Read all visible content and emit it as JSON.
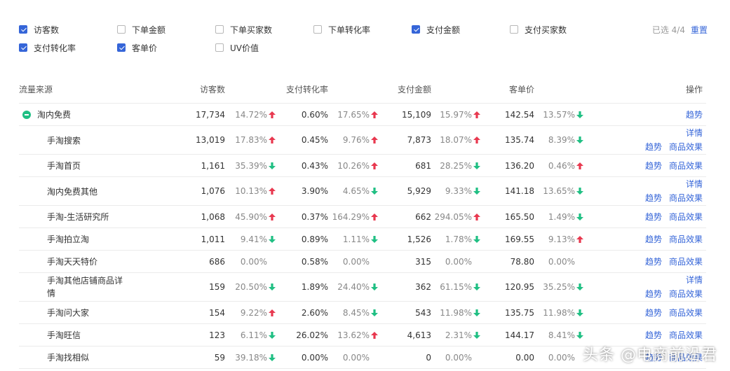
{
  "filters": [
    {
      "label": "访客数",
      "checked": true,
      "name": "filter-visitors"
    },
    {
      "label": "下单金额",
      "checked": false,
      "name": "filter-order-amount"
    },
    {
      "label": "下单买家数",
      "checked": false,
      "name": "filter-order-buyers"
    },
    {
      "label": "下单转化率",
      "checked": false,
      "name": "filter-order-conversion"
    },
    {
      "label": "支付金额",
      "checked": true,
      "name": "filter-pay-amount"
    },
    {
      "label": "支付买家数",
      "checked": false,
      "name": "filter-pay-buyers"
    },
    {
      "label": "支付转化率",
      "checked": true,
      "name": "filter-pay-conversion"
    },
    {
      "label": "客单价",
      "checked": true,
      "name": "filter-unit-price"
    },
    {
      "label": "UV价值",
      "checked": false,
      "name": "filter-uv-value"
    }
  ],
  "selection": {
    "count_text": "已选 4/4",
    "reset_label": "重置"
  },
  "table": {
    "headers": {
      "source": "流量来源",
      "visitors": "访客数",
      "pay_conversion": "支付转化率",
      "pay_amount": "支付金额",
      "unit_price": "客单价",
      "actions": "操作"
    },
    "rows": [
      {
        "source": "淘内免费",
        "parent": true,
        "v1": "17,734",
        "p1": "14.72%",
        "d1": "up",
        "v2": "0.60%",
        "p2": "17.65%",
        "d2": "up",
        "v3": "15,109",
        "p3": "15.97%",
        "d3": "up",
        "v4": "142.54",
        "p4": "13.57%",
        "d4": "down",
        "ops": "trend"
      },
      {
        "source": "手淘搜索",
        "v1": "13,019",
        "p1": "17.83%",
        "d1": "up",
        "v2": "0.45%",
        "p2": "9.76%",
        "d2": "up",
        "v3": "7,873",
        "p3": "18.07%",
        "d3": "up",
        "v4": "135.74",
        "p4": "8.39%",
        "d4": "down",
        "ops": "detail"
      },
      {
        "source": "手淘首页",
        "v1": "1,161",
        "p1": "35.39%",
        "d1": "down",
        "v2": "0.43%",
        "p2": "10.26%",
        "d2": "up",
        "v3": "681",
        "p3": "28.25%",
        "d3": "down",
        "v4": "136.20",
        "p4": "0.46%",
        "d4": "up",
        "ops": "pair"
      },
      {
        "source": "淘内免费其他",
        "v1": "1,076",
        "p1": "10.13%",
        "d1": "up",
        "v2": "3.90%",
        "p2": "4.65%",
        "d2": "down",
        "v3": "5,929",
        "p3": "9.33%",
        "d3": "down",
        "v4": "141.18",
        "p4": "13.65%",
        "d4": "down",
        "ops": "detail"
      },
      {
        "source": "手淘-生活研究所",
        "v1": "1,068",
        "p1": "45.90%",
        "d1": "up",
        "v2": "0.37%",
        "p2": "164.29%",
        "d2": "up",
        "v3": "662",
        "p3": "294.05%",
        "d3": "up",
        "v4": "165.50",
        "p4": "1.49%",
        "d4": "down",
        "ops": "pair"
      },
      {
        "source": "手淘拍立淘",
        "v1": "1,011",
        "p1": "9.41%",
        "d1": "down",
        "v2": "0.89%",
        "p2": "1.11%",
        "d2": "down",
        "v3": "1,526",
        "p3": "1.78%",
        "d3": "down",
        "v4": "169.55",
        "p4": "9.13%",
        "d4": "up",
        "ops": "pair"
      },
      {
        "source": "手淘天天特价",
        "v1": "686",
        "p1": "0.00%",
        "d1": "",
        "v2": "0.58%",
        "p2": "0.00%",
        "d2": "",
        "v3": "315",
        "p3": "0.00%",
        "d3": "",
        "v4": "78.80",
        "p4": "0.00%",
        "d4": "",
        "ops": "pair"
      },
      {
        "source": "手淘其他店铺商品详情",
        "wrap": true,
        "v1": "159",
        "p1": "20.50%",
        "d1": "down",
        "v2": "1.89%",
        "p2": "24.40%",
        "d2": "down",
        "v3": "362",
        "p3": "61.15%",
        "d3": "down",
        "v4": "120.95",
        "p4": "35.25%",
        "d4": "down",
        "ops": "detail"
      },
      {
        "source": "手淘问大家",
        "v1": "154",
        "p1": "9.22%",
        "d1": "up",
        "v2": "2.60%",
        "p2": "8.45%",
        "d2": "down",
        "v3": "543",
        "p3": "11.98%",
        "d3": "down",
        "v4": "135.75",
        "p4": "11.98%",
        "d4": "down",
        "ops": "pair"
      },
      {
        "source": "手淘旺信",
        "v1": "123",
        "p1": "6.11%",
        "d1": "down",
        "v2": "26.02%",
        "p2": "13.62%",
        "d2": "up",
        "v3": "4,613",
        "p3": "2.31%",
        "d3": "down",
        "v4": "144.17",
        "p4": "8.41%",
        "d4": "down",
        "ops": "pair"
      },
      {
        "source": "手淘找相似",
        "v1": "59",
        "p1": "39.18%",
        "d1": "down",
        "v2": "0.00%",
        "p2": "0.00%",
        "d2": "",
        "v3": "0",
        "p3": "0.00%",
        "d3": "",
        "v4": "0.00",
        "p4": "0.00%",
        "d4": "",
        "ops": "pair"
      }
    ],
    "action_labels": {
      "trend": "趋势",
      "detail": "详情",
      "product_effect": "商品效果"
    }
  },
  "colors": {
    "up": "#e8384f",
    "down": "#1fbf83",
    "link": "#3565d8"
  },
  "watermark": "头条 @电商前沿君"
}
